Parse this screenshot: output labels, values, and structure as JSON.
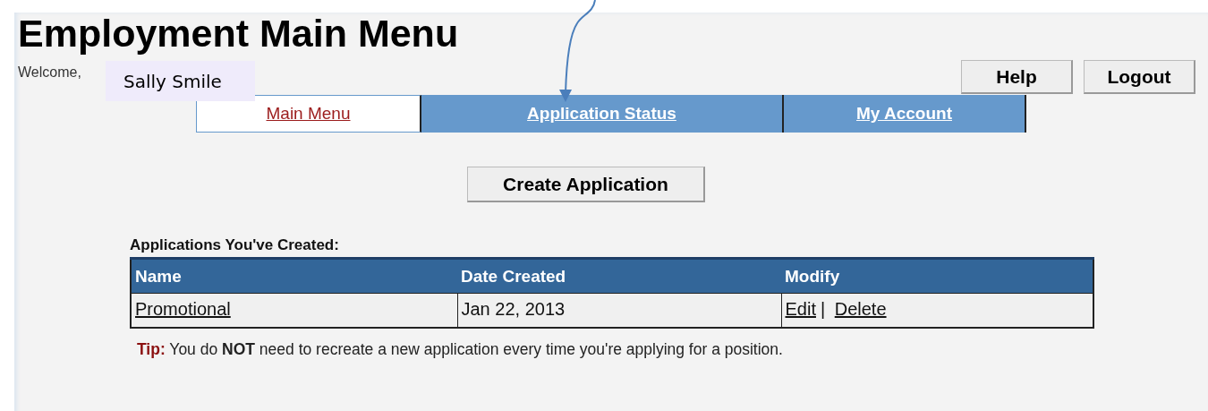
{
  "page": {
    "title": "Employment Main Menu",
    "welcome": "Welcome,"
  },
  "annotation": {
    "label": "Sally Smile"
  },
  "header_buttons": [
    "Help",
    "Logout"
  ],
  "tabs": [
    {
      "label": "Main Menu",
      "selected": true
    },
    {
      "label": "Application Status",
      "selected": false
    },
    {
      "label": "My Account",
      "selected": false
    }
  ],
  "create_button": "Create Application",
  "table": {
    "caption": "Applications You've Created:",
    "columns": [
      "Name",
      "Date Created",
      "Modify"
    ],
    "rows": [
      {
        "name": "Promotional",
        "date": "Jan 22, 2013",
        "actions": [
          "Edit",
          "Delete"
        ],
        "separator": "|"
      }
    ]
  },
  "tip": {
    "label": "Tip:",
    "text": "You do **NOT** need to recreate a new application every time you're applying for a position."
  }
}
